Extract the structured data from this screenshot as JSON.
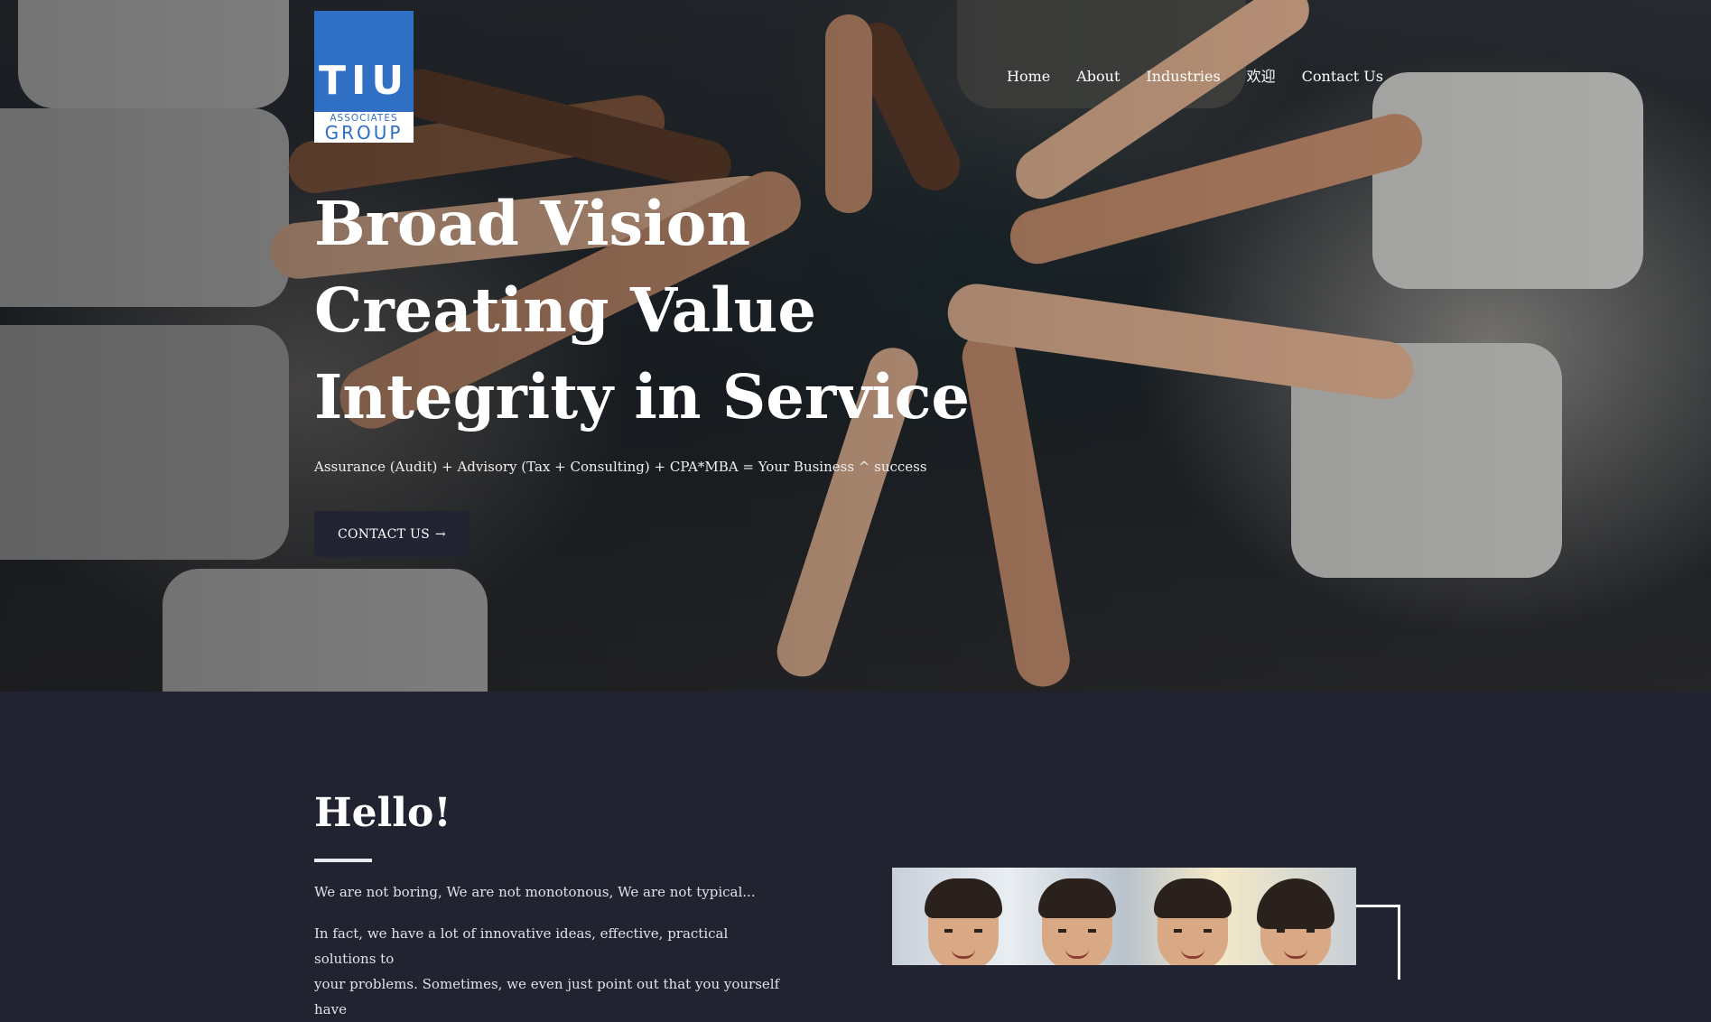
{
  "brand": {
    "logo_main": "TIU",
    "logo_line1": "ASSOCIATES",
    "logo_line2": "GROUP",
    "color": "#2f6fc4"
  },
  "nav": {
    "items": [
      {
        "label": "Home"
      },
      {
        "label": "About"
      },
      {
        "label": "Industries"
      },
      {
        "label": "欢迎"
      },
      {
        "label": "Contact Us"
      }
    ]
  },
  "hero": {
    "title_lines": [
      "Broad Vision",
      "Creating Value",
      "Integrity in Service"
    ],
    "subtitle": "Assurance (Audit) + Advisory (Tax + Consulting) + CPA*MBA = Your Business ^ success",
    "cta_label": "CONTACT US",
    "cta_icon": "arrow-right-icon",
    "background_image": "team-hands-stacked-photo"
  },
  "hello": {
    "title": "Hello!",
    "paragraph1": "We are not boring, We are not monotonous, We are not typical...",
    "paragraph2_line1": "In fact, we have a lot of innovative ideas, effective, practical solutions to",
    "paragraph2_line2": "your problems. Sometimes, we even just point out that you yourself have",
    "image": "team-photo"
  },
  "colors": {
    "page_bg": "#212331",
    "button_bg": "#222434",
    "text": "#ffffff"
  }
}
